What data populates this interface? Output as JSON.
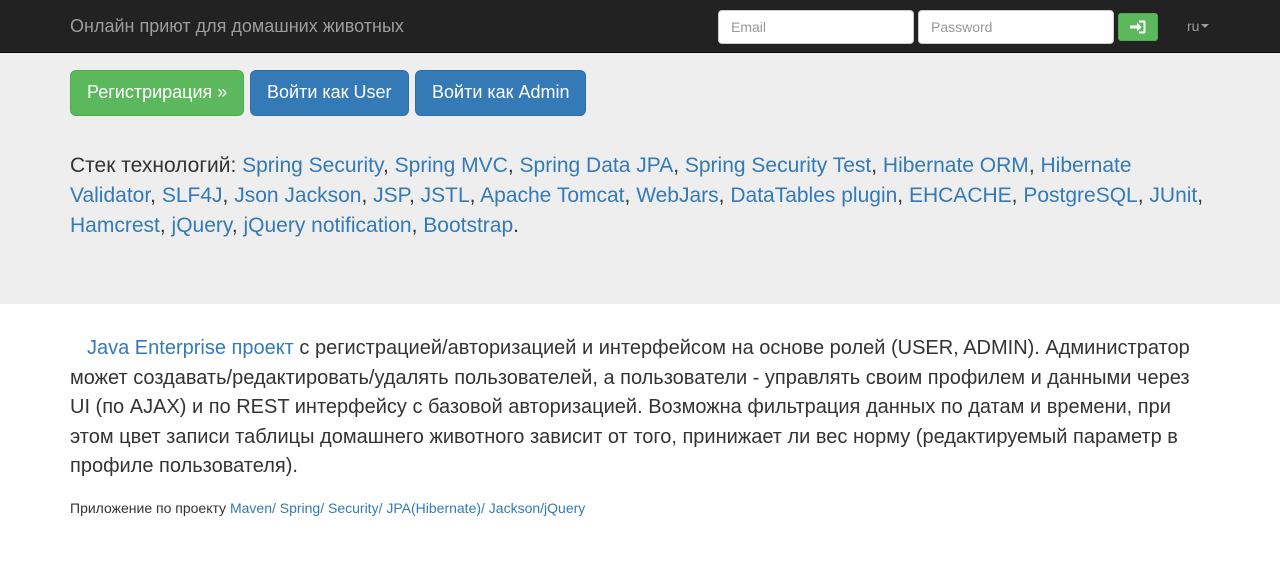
{
  "navbar": {
    "brand": "Онлайн приют для домашних животных",
    "email_placeholder": "Email",
    "password_placeholder": "Password",
    "login_icon": "sign-in-icon",
    "language": "ru"
  },
  "jumbotron": {
    "buttons": {
      "register": "Регистрирация »",
      "login_user": "Войти как User",
      "login_admin": "Войти как Admin"
    },
    "stack_label": "Стек технологий: ",
    "technologies": [
      "Spring Security",
      "Spring MVC",
      "Spring Data JPA",
      "Spring Security Test",
      "Hibernate ORM",
      "Hibernate Validator",
      "SLF4J",
      "Json Jackson",
      "JSP",
      "JSTL",
      "Apache Tomcat",
      "WebJars",
      "DataTables plugin",
      "EHCACHE",
      "PostgreSQL",
      "JUnit",
      "Hamcrest",
      "jQuery",
      "jQuery notification",
      "Bootstrap"
    ],
    "separator": ", ",
    "stack_end": "."
  },
  "description": {
    "link_text": "Java Enterprise проект",
    "text": " с регистрацией/авторизацией и интерфейсом на основе ролей (USER, ADMIN). Администратор может создавать/редактировать/удалять пользователей, а пользователи - управлять своим профилем и данными через UI (по AJAX) и по REST интерфейсу с базовой авторизацией. Возможна фильтрация данных по датам и времени, при этом цвет записи таблицы домашнего животного зависит от того, принижает ли вес норму (редактируемый параметр в профиле пользователя)."
  },
  "footer": {
    "label": "Приложение по проекту ",
    "link_text": "Maven/ Spring/ Security/ JPA(Hibernate)/ Jackson/jQuery"
  },
  "colors": {
    "navbar_bg": "#222222",
    "success": "#5cb85c",
    "primary": "#337ab7",
    "jumbotron_bg": "#eeeeee"
  }
}
